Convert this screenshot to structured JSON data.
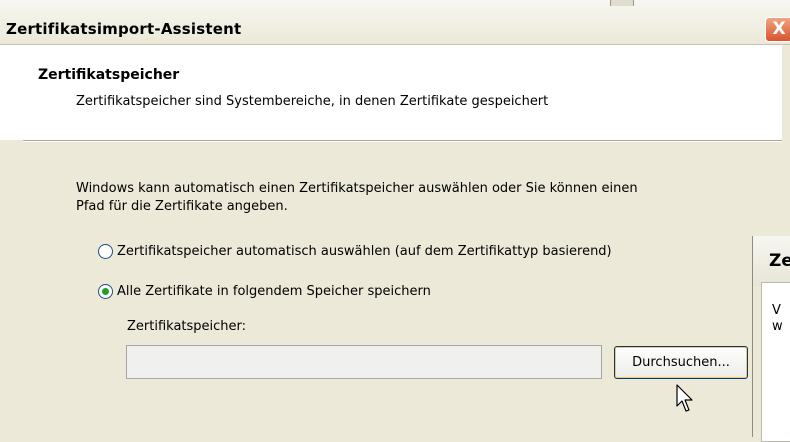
{
  "window": {
    "title": "Zertifikatsimport-Assistent",
    "close_glyph": "X"
  },
  "header": {
    "title": "Zertifikatspeicher",
    "subtitle": "Zertifikatspeicher sind Systembereiche, in denen Zertifikate gespeichert"
  },
  "content": {
    "intro_line1": "Windows kann automatisch einen Zertifikatspeicher auswählen oder Sie können einen",
    "intro_line2": "Pfad für die Zertifikate angeben.",
    "radio_auto_label": "Zertifikatspeicher automatisch auswählen (auf dem Zertifikattyp basierend)",
    "radio_manual_label": "Alle Zertifikate in folgendem Speicher speichern",
    "store_label": "Zertifikatspeicher:",
    "store_value": "",
    "browse_label": "Durchsuchen..."
  },
  "state": {
    "radio_auto_selected": false,
    "radio_manual_selected": true
  },
  "background_dialog": {
    "title_fragment": "Ze",
    "line1": "V",
    "line2": "w"
  },
  "icons": {
    "close": "close-icon",
    "cursor": "mouse-pointer-icon"
  },
  "colors": {
    "accent_green": "#21a121",
    "close_red": "#d9532c",
    "button_border": "#003c74"
  }
}
